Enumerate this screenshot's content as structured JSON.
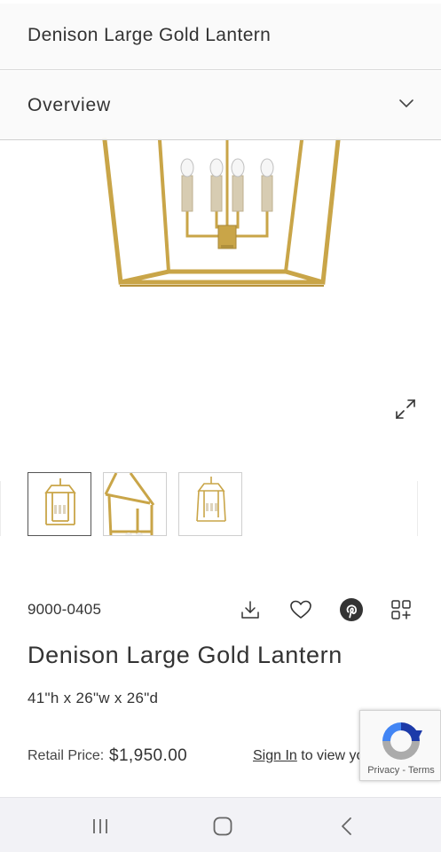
{
  "header": {
    "title": "Denison Large Gold Lantern"
  },
  "overview": {
    "label": "Overview",
    "icon": "chevron-down-icon"
  },
  "gallery": {
    "expand_icon": "expand-icon",
    "thumbnails": [
      "thumbnail-1",
      "thumbnail-2",
      "thumbnail-3"
    ],
    "selected_index": 0,
    "lantern_color": "#c9a548"
  },
  "product": {
    "sku": "9000-0405",
    "title": "Denison Large Gold Lantern",
    "dimensions": "41\"h x 26\"w x 26\"d",
    "retail_price_label": "Retail Price:",
    "retail_price": "$1,950.00",
    "sign_in_link": "Sign In",
    "sign_in_text": " to view your price"
  },
  "actions": [
    "download-icon",
    "heart-icon",
    "pinterest-icon",
    "add-to-collection-icon"
  ],
  "recaptcha": {
    "privacy": "Privacy",
    "separator": " - ",
    "terms": "Terms"
  },
  "nav": [
    "recent-apps-icon",
    "home-icon",
    "back-icon"
  ]
}
